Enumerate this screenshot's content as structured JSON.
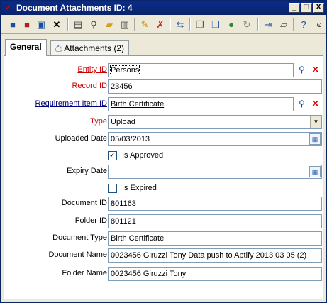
{
  "window": {
    "title": "Document Attachments ID: 4",
    "minimize": "_",
    "maximize": "□",
    "close": "X"
  },
  "toolbar": {
    "icons": [
      "save-icon",
      "save-close-icon",
      "save-new-icon",
      "delete-icon",
      "print-icon",
      "find-icon",
      "open-folder-icon",
      "notes-icon",
      "wizard-icon",
      "delete-record-icon",
      "link-icon",
      "copy-icon",
      "attach-icon",
      "web-icon",
      "refresh-icon",
      "forward-icon",
      "document-icon",
      "help-icon",
      "expand-icon"
    ]
  },
  "tabs": [
    {
      "label": "General"
    },
    {
      "label": "Attachments (2)"
    }
  ],
  "form": {
    "entity_id": {
      "label": "Entity ID",
      "value": "Persons"
    },
    "record_id": {
      "label": "Record ID",
      "value": "23456"
    },
    "requirement_item_id": {
      "label": "Requirement Item ID",
      "value": "Birth Certificate"
    },
    "type": {
      "label": "Type",
      "value": "Upload"
    },
    "uploaded_date": {
      "label": "Uploaded Date",
      "value": "05/03/2013"
    },
    "is_approved": {
      "label": "Is Approved",
      "checked": true,
      "mark": "✓"
    },
    "expiry_date": {
      "label": "Expiry Date",
      "value": ""
    },
    "is_expired": {
      "label": "Is Expired",
      "checked": false
    },
    "document_id": {
      "label": "Document ID",
      "value": "801163"
    },
    "folder_id": {
      "label": "Folder ID",
      "value": "801121"
    },
    "document_type": {
      "label": "Document Type",
      "value": "Birth Certificate"
    },
    "document_name": {
      "label": "Document Name",
      "value": "0023456 Giruzzi Tony Data push to Aptify 2013 03 05 (2)"
    },
    "folder_name": {
      "label": "Folder Name",
      "value": "0023456 Giruzzi Tony"
    }
  }
}
